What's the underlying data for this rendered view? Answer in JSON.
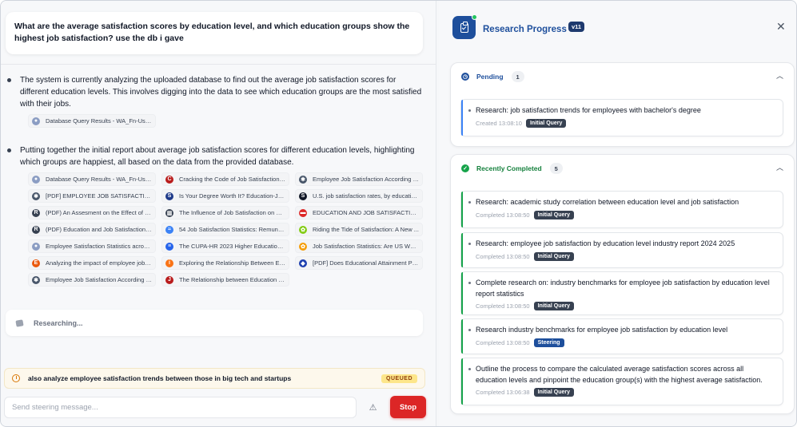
{
  "chat": {
    "user_message": "What are the average satisfaction scores by education level, and which education groups show the highest job satisfaction? use the db i gave",
    "steps": [
      {
        "text": "The system is currently analyzing the uploaded database to find out the average job satisfaction scores for different education levels. This involves digging into the data to see which education groups are the most satisfied with their jobs.",
        "sources": [
          {
            "label": "Database Query Results - WA_Fn-UseC...",
            "icon": "database-icon",
            "color": "#8b9dc3"
          }
        ]
      },
      {
        "text": "Putting together the initial report about average job satisfaction scores for different education levels, highlighting which groups are happiest, all based on the data from the provided database.",
        "sources": [
          {
            "label": "Database Query Results - WA_Fn-UseC...",
            "icon": "database-icon",
            "color": "#8b9dc3"
          },
          {
            "label": "Cracking the Code of Job Satisfaction: ...",
            "icon": "c-logo-icon",
            "color": "#b91c1c"
          },
          {
            "label": "Employee Job Satisfaction According to...",
            "icon": "pinwheel-icon",
            "color": "#475569"
          },
          {
            "label": "[PDF] EMPLOYEE JOB SATISFACTION A...",
            "icon": "pinwheel-icon",
            "color": "#475569"
          },
          {
            "label": "Is Your Degree Worth It? Education-Job ...",
            "icon": "s-logo-icon",
            "color": "#1e3a8a"
          },
          {
            "label": "U.S. job satisfaction rates, by education...",
            "icon": "s-swirl-icon",
            "color": "#111827"
          },
          {
            "label": "(PDF) An Assesment on the Effect of Ed...",
            "icon": "rg-logo-icon",
            "color": "#374151"
          },
          {
            "label": "The Influence of Job Satisfaction on Em...",
            "icon": "building-icon",
            "color": "#374151"
          },
          {
            "label": "EDUCATION AND JOB SATISFACTION I...",
            "icon": "journal-icon",
            "color": "#dc2626"
          },
          {
            "label": "(PDF) Education and Job Satisfaction - ...",
            "icon": "rg-logo-icon",
            "color": "#374151"
          },
          {
            "label": "54 Job Satisfaction Statistics: Remuner...",
            "icon": "wave-icon",
            "color": "#3b82f6"
          },
          {
            "label": "Riding the Tide of Satisfaction: A New ...",
            "icon": "leaf-icon",
            "color": "#84cc16"
          },
          {
            "label": "Employee Satisfaction Statistics across ...",
            "icon": "globe-icon",
            "color": "#8b9dc3"
          },
          {
            "label": "The CUPA-HR 2023 Higher Education E...",
            "icon": "cupa-icon",
            "color": "#2563eb"
          },
          {
            "label": "Job Satisfaction Statistics: Are US Work...",
            "icon": "flower-icon",
            "color": "#f59e0b"
          },
          {
            "label": "Analyzing the impact of employee job s...",
            "icon": "e-logo-icon",
            "color": "#ea580c"
          },
          {
            "label": "Exploring the Relationship Between Edu...",
            "icon": "info-circle-icon",
            "color": "#f97316"
          },
          {
            "label": "[PDF] Does Educational Attainment Pro...",
            "icon": "shield-logo-icon",
            "color": "#1e40af"
          },
          {
            "label": "Employee Job Satisfaction According to...",
            "icon": "pinwheel-icon",
            "color": "#475569"
          },
          {
            "label": "The Relationship between Education an...",
            "icon": "j-logo-icon",
            "color": "#b91c1c"
          }
        ]
      }
    ],
    "status": "Researching...",
    "queued_message": "also analyze employee satisfaction trends between those in big tech and startups",
    "queued_badge": "QUEUED",
    "input_placeholder": "Send steering message...",
    "stop_label": "Stop"
  },
  "progress": {
    "title": "Research Progress",
    "version": "v11",
    "pending": {
      "label": "Pending",
      "count": "1",
      "items": [
        {
          "text": "Research: job satisfaction trends for employees with bachelor's degree",
          "meta": "Created 13:08:10",
          "tag": "Initial Query"
        }
      ]
    },
    "completed": {
      "label": "Recently Completed",
      "count": "5",
      "items": [
        {
          "text": "Research: academic study correlation between education level and job satisfaction",
          "meta": "Completed 13:08:50",
          "tag": "Initial Query"
        },
        {
          "text": "Research: employee job satisfaction by education level industry report 2024 2025",
          "meta": "Completed 13:08:50",
          "tag": "Initial Query"
        },
        {
          "text": "Complete research on: industry benchmarks for employee job satisfaction by education level report statistics",
          "meta": "Completed 13:08:50",
          "tag": "Initial Query"
        },
        {
          "text": "Research industry benchmarks for employee job satisfaction by education level",
          "meta": "Completed 13:08:50",
          "tag": "Steering"
        },
        {
          "text": "Outline the process to compare the calculated average satisfaction scores across all education levels and pinpoint the education group(s) with the highest average satisfaction.",
          "meta": "Completed 13:06:38",
          "tag": "Initial Query"
        }
      ]
    }
  },
  "colors": {
    "brand": "#1e4f9c",
    "pending_accent": "#3b82f6",
    "completed_accent": "#16a34a",
    "stop": "#dc2626",
    "tag_initial": "#374151",
    "tag_steering": "#1e4f9c"
  }
}
